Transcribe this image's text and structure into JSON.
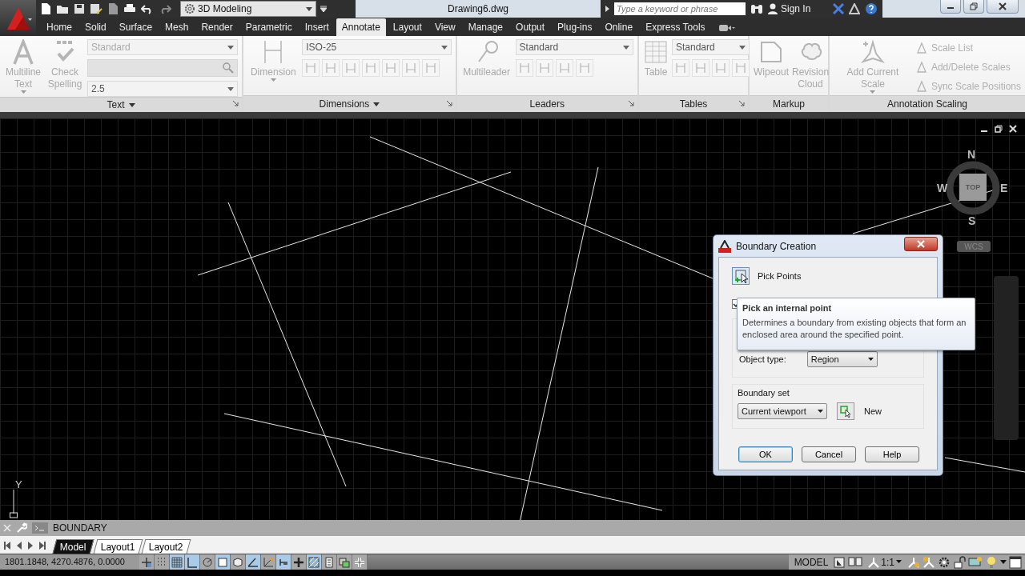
{
  "app": {
    "workspace": "3D Modeling",
    "title": "Drawing6.dwg",
    "search": {
      "placeholder": "Type a keyword or phrase"
    },
    "sign_in": "Sign In"
  },
  "ribbon_tabs": [
    {
      "label": "Home",
      "selected": false
    },
    {
      "label": "Solid",
      "selected": false
    },
    {
      "label": "Surface",
      "selected": false
    },
    {
      "label": "Mesh",
      "selected": false
    },
    {
      "label": "Render",
      "selected": false
    },
    {
      "label": "Parametric",
      "selected": false
    },
    {
      "label": "Insert",
      "selected": false
    },
    {
      "label": "Annotate",
      "selected": true
    },
    {
      "label": "Layout",
      "selected": false
    },
    {
      "label": "View",
      "selected": false
    },
    {
      "label": "Manage",
      "selected": false
    },
    {
      "label": "Output",
      "selected": false
    },
    {
      "label": "Plug-ins",
      "selected": false
    },
    {
      "label": "Online",
      "selected": false
    },
    {
      "label": "Express Tools",
      "selected": false
    }
  ],
  "panels": [
    {
      "title": "Text",
      "menu": true,
      "launcher": true,
      "buttons": [
        {
          "label": "Multiline Text",
          "disabled": true,
          "dropdown": true
        },
        {
          "label": "Check Spelling",
          "disabled": true,
          "dropdown": false
        }
      ],
      "combos": [
        {
          "value": "Standard",
          "disabled": true
        },
        {
          "value": "2.5",
          "disabled": false
        }
      ]
    },
    {
      "title": "Dimensions",
      "menu": true,
      "launcher": true,
      "buttons": [
        {
          "label": "Dimension",
          "disabled": true,
          "dropdown": true
        }
      ],
      "combos": [
        {
          "value": "ISO-25",
          "disabled": false
        }
      ]
    },
    {
      "title": "Leaders",
      "menu": false,
      "launcher": true,
      "buttons": [
        {
          "label": "Multileader",
          "disabled": true,
          "dropdown": false
        }
      ],
      "combos": [
        {
          "value": "Standard",
          "disabled": false
        }
      ]
    },
    {
      "title": "Tables",
      "menu": false,
      "launcher": true,
      "buttons": [
        {
          "label": "Table",
          "disabled": true,
          "dropdown": false
        }
      ],
      "combos": [
        {
          "value": "Standard",
          "disabled": false
        }
      ]
    },
    {
      "title": "Markup",
      "menu": false,
      "launcher": false,
      "buttons": [
        {
          "label": "Wipeout",
          "disabled": true,
          "dropdown": false
        },
        {
          "label": "Revision Cloud",
          "disabled": true,
          "dropdown": false
        }
      ]
    },
    {
      "title": "Annotation Scaling",
      "menu": false,
      "launcher": false,
      "buttons": [
        {
          "label": "Add Current Scale",
          "disabled": true,
          "dropdown": true
        }
      ],
      "small_buttons": [
        {
          "label": "Scale List",
          "disabled": true
        },
        {
          "label": "Add/Delete Scales",
          "disabled": true
        },
        {
          "label": "Sync Scale Positions",
          "disabled": true
        }
      ]
    }
  ],
  "viewcube": {
    "north": "N",
    "west": "W",
    "east": "E",
    "south": "S",
    "face": "TOP",
    "ucs": "WCS"
  },
  "ucs_axis": "Y",
  "dialog": {
    "title": "Boundary Creation",
    "pick_points": "Pick Points",
    "island_detection": {
      "checked": true
    },
    "object_type": {
      "label": "Object type:",
      "value": "Region"
    },
    "boundary_set": {
      "label": "Boundary set",
      "value": "Current viewport",
      "new_label": "New"
    },
    "buttons": [
      {
        "label": "OK",
        "default": true
      },
      {
        "label": "Cancel",
        "default": false
      },
      {
        "label": "Help",
        "default": false
      }
    ]
  },
  "tooltip": {
    "title": "Pick an internal point",
    "text": "Determines a boundary from existing objects that form an enclosed area around the specified point."
  },
  "command_line": {
    "command": "BOUNDARY"
  },
  "layout_tabs": [
    {
      "label": "Model",
      "selected": true
    },
    {
      "label": "Layout1",
      "selected": false
    },
    {
      "label": "Layout2",
      "selected": false
    }
  ],
  "status_bar": {
    "coordinates": "1801.1848, 4270.4876, 0.0000",
    "toggles": [
      {
        "on": false
      },
      {
        "on": false
      },
      {
        "on": true
      },
      {
        "on": true
      },
      {
        "on": false
      },
      {
        "on": true
      },
      {
        "on": false
      },
      {
        "on": true
      },
      {
        "on": false
      },
      {
        "on": true
      },
      {
        "on": false
      },
      {
        "on": true
      },
      {
        "on": false
      },
      {
        "on": false
      },
      {
        "on": false
      }
    ],
    "space": "MODEL",
    "scale": "1:1"
  }
}
